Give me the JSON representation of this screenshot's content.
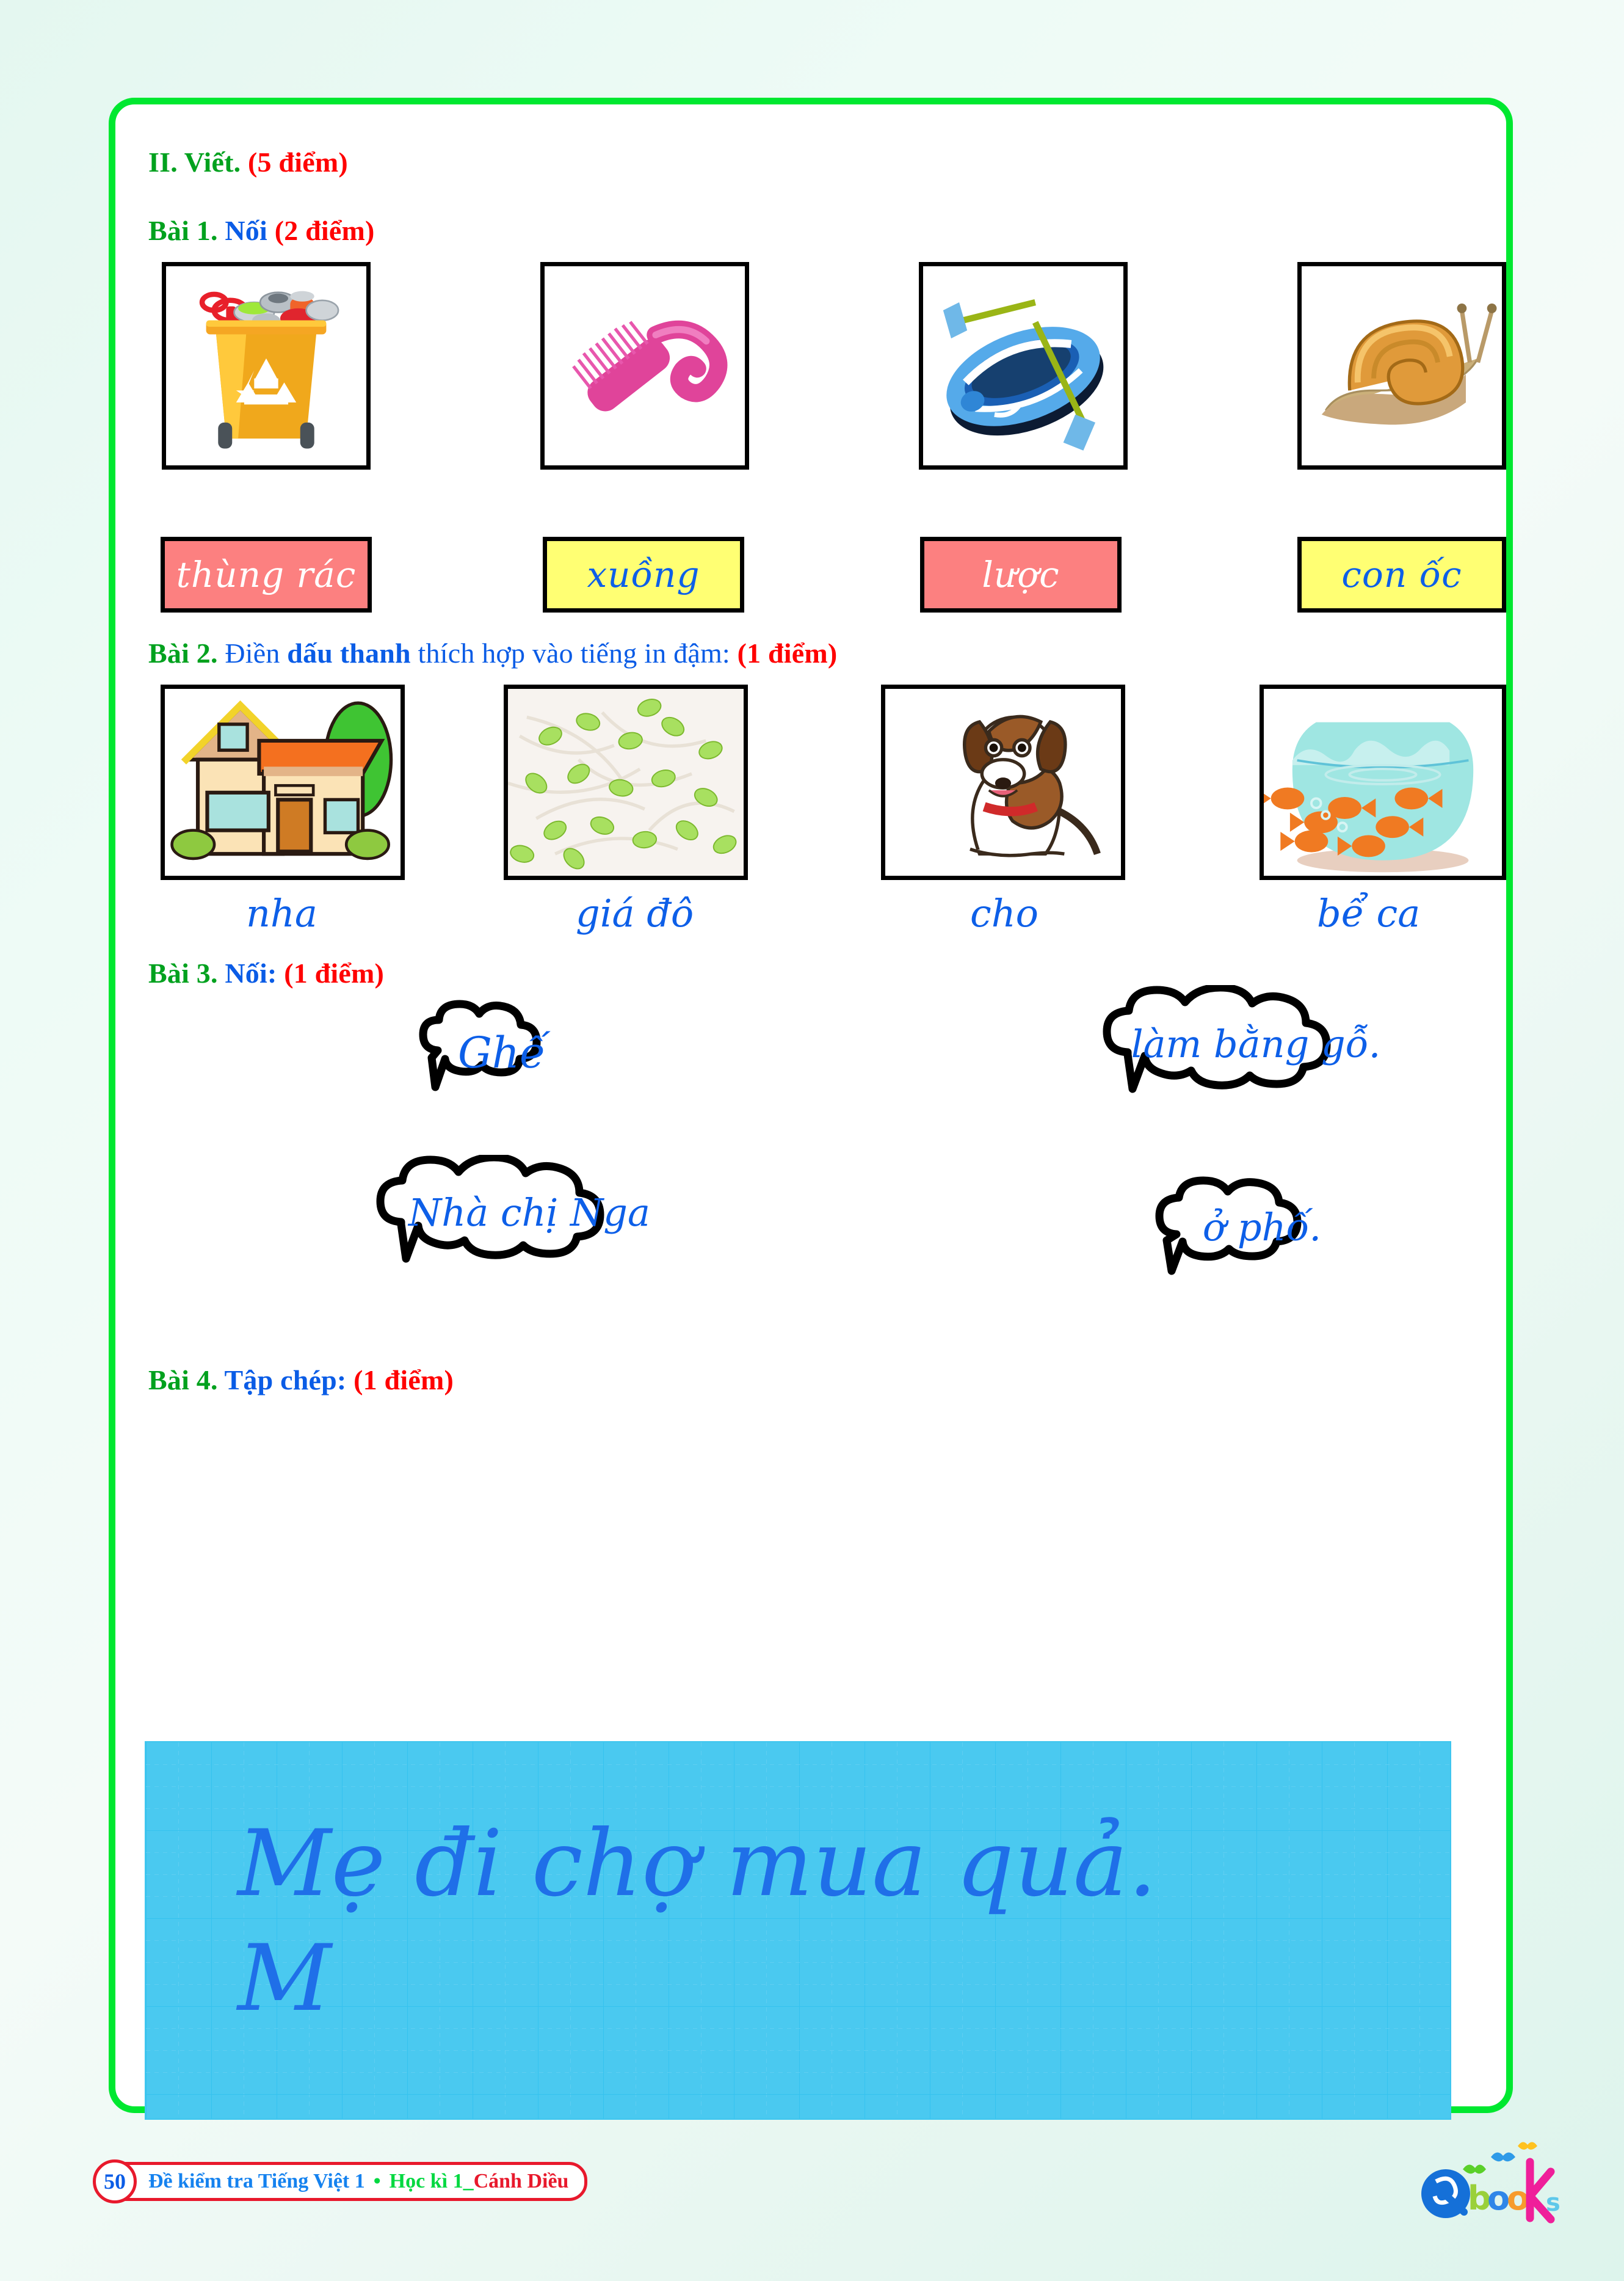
{
  "page": {
    "border_color": "#00e830",
    "background": "#e9f8f2"
  },
  "section": {
    "number": "II.",
    "title": "Viết.",
    "points": "(5 điểm)"
  },
  "exercises": [
    {
      "id": "bai-1",
      "label": "Bài 1.",
      "instruction": "Nối",
      "points": "(2 điểm)",
      "pictures": [
        {
          "name": "trash-bin-picture",
          "alt": "thùng rác"
        },
        {
          "name": "comb-picture",
          "alt": "lược"
        },
        {
          "name": "boat-picture",
          "alt": "xuồng"
        },
        {
          "name": "snail-picture",
          "alt": "con ốc"
        }
      ],
      "word_cards": [
        {
          "text": "thùng rác",
          "bg": "#fc8080",
          "fg": "#ffffff"
        },
        {
          "text": "xuồng",
          "bg": "#ffff73",
          "fg": "#0d5fe8"
        },
        {
          "text": "lược",
          "bg": "#fc8080",
          "fg": "#ffffff"
        },
        {
          "text": "con ốc",
          "bg": "#ffff73",
          "fg": "#0d5fe8"
        }
      ]
    },
    {
      "id": "bai-2",
      "label": "Bài 2.",
      "instruction_pre": "Điền",
      "instruction_bold": "dấu thanh",
      "instruction_post": "thích hợp vào tiếng in đậm:",
      "points": "(1 điểm)",
      "pictures": [
        {
          "name": "house-picture",
          "alt": "nhà"
        },
        {
          "name": "bean-sprouts-picture",
          "alt": "giá đỗ"
        },
        {
          "name": "dog-picture",
          "alt": "chó"
        },
        {
          "name": "fishbowl-picture",
          "alt": "bể cá"
        }
      ],
      "words": [
        "nha",
        "giá đô",
        "cho",
        "bể ca"
      ]
    },
    {
      "id": "bai-3",
      "label": "Bài 3.",
      "instruction": "Nối:",
      "points": "(1 điểm)",
      "bubbles": [
        {
          "text": "Ghế",
          "position": "top-left"
        },
        {
          "text": "làm bằng gỗ.",
          "position": "top-right"
        },
        {
          "text": "Nhà chị Nga",
          "position": "bottom-left"
        },
        {
          "text": "ở phố.",
          "position": "bottom-right"
        }
      ]
    },
    {
      "id": "bai-4",
      "label": "Bài 4.",
      "instruction": "Tập chép:",
      "points": "(1 điểm)",
      "copy_lines": [
        "Mẹ đi chợ mua quả.",
        "M"
      ]
    }
  ],
  "footer": {
    "page_number": "50",
    "title": "Đề kiểm tra Tiếng Việt 1",
    "separator": "•",
    "term": "Học kì 1_",
    "series": "Cánh Diều",
    "logo_text": "Qbooks"
  }
}
